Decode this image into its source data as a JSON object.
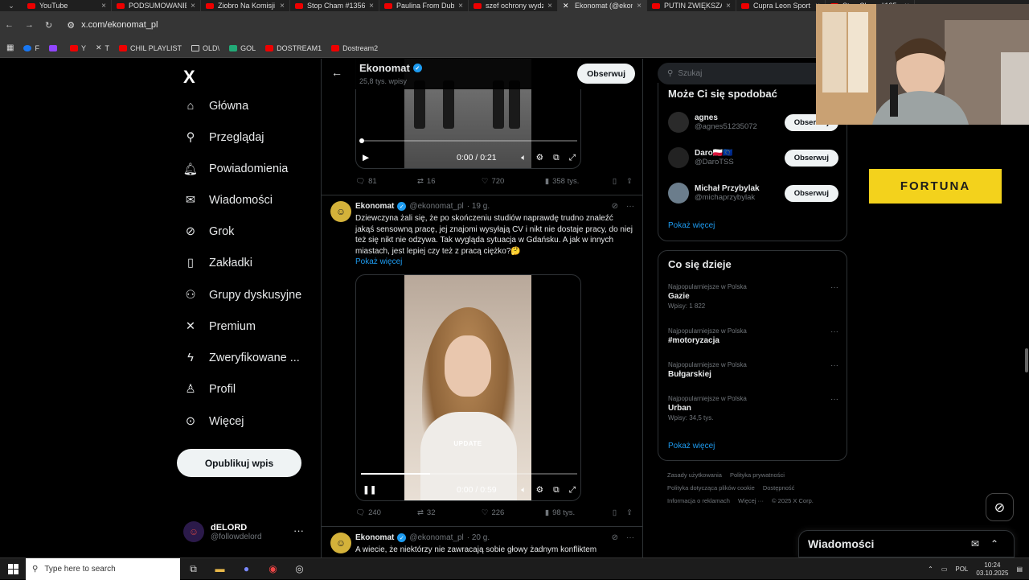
{
  "browser": {
    "tabs": [
      {
        "title": "YouTube",
        "icon": "youtube-icon"
      },
      {
        "title": "PODSUMOWANIE",
        "icon": "youtube-icon"
      },
      {
        "title": "Ziobro Na Komisji",
        "icon": "youtube-icon"
      },
      {
        "title": "Stop Cham #1356",
        "icon": "youtube-icon"
      },
      {
        "title": "Paulina From Dub",
        "icon": "youtube-icon"
      },
      {
        "title": "szef ochrony wydz",
        "icon": "youtube-icon"
      },
      {
        "title": "Ekonomat (@ekon",
        "icon": "x-icon",
        "active": true
      },
      {
        "title": "PUTIN ZWIĘKSZA",
        "icon": "youtube-icon"
      },
      {
        "title": "Cupra Leon Sport",
        "icon": "youtube-icon"
      },
      {
        "title": "Stop Cham #135",
        "icon": "youtube-icon"
      }
    ],
    "url": "x.com/ekonomat_pl",
    "bookmarks": [
      {
        "label": "F",
        "icon": "facebook-icon"
      },
      {
        "label": "",
        "icon": "twitch-icon"
      },
      {
        "label": "Y",
        "icon": "youtube-icon"
      },
      {
        "label": "T",
        "icon": "x-icon"
      },
      {
        "label": "CHIL PLAYLIST",
        "icon": "youtube-icon"
      },
      {
        "label": "OLD\\",
        "icon": "folder-icon"
      },
      {
        "label": "GOL",
        "icon": "gol-icon"
      },
      {
        "label": "DOSTREAM1",
        "icon": "youtube-icon"
      },
      {
        "label": "Dostream2",
        "icon": "youtube-icon"
      }
    ]
  },
  "nav": {
    "logo": "X",
    "items": [
      {
        "label": "Główna",
        "icon": "home-icon",
        "glyph": "⌂"
      },
      {
        "label": "Przeglądaj",
        "icon": "search-icon",
        "glyph": "⚲"
      },
      {
        "label": "Powiadomienia",
        "icon": "bell-icon",
        "glyph": "🔔︎"
      },
      {
        "label": "Wiadomości",
        "icon": "mail-icon",
        "glyph": "✉"
      },
      {
        "label": "Grok",
        "icon": "grok-icon",
        "glyph": "⊘"
      },
      {
        "label": "Zakładki",
        "icon": "bookmark-icon",
        "glyph": "▯"
      },
      {
        "label": "Grupy dyskusyjne",
        "icon": "people-icon",
        "glyph": "⚇"
      },
      {
        "label": "Premium",
        "icon": "x-premium-icon",
        "glyph": "✕"
      },
      {
        "label": "Zweryfikowane ...",
        "icon": "lightning-icon",
        "glyph": "ϟ"
      },
      {
        "label": "Profil",
        "icon": "profile-icon",
        "glyph": "♙"
      },
      {
        "label": "Więcej",
        "icon": "more-circle-icon",
        "glyph": "⊙"
      }
    ],
    "post_button": "Opublikuj wpis",
    "user": {
      "name": "dELORD",
      "handle": "@followdelord"
    }
  },
  "main": {
    "title": "Ekonomat",
    "subtitle": "25,8 tys. wpisy",
    "follow": "Obserwuj",
    "video1": {
      "time": "0:00 / 0:21"
    },
    "tweet1_stats": {
      "replies": "81",
      "reposts": "16",
      "likes": "720",
      "views": "358 tys."
    },
    "tweet2": {
      "name": "Ekonomat",
      "handle": "@ekonomat_pl",
      "time": "· 19 g.",
      "text": "Dziewczyna żali się, że po skończeniu studiów naprawdę trudno znaleźć jakąś sensowną pracę, jej znajomi wysyłają CV i nikt nie dostaje pracy, do niej też się nikt nie odzywa. Tak wygląda sytuacja w Gdańsku. A jak w innych miastach, jest lepiej czy też z pracą ciężko?🤔",
      "show_more": "Pokaż więcej",
      "video_overlay": "UPDATE",
      "video_time": "0:00 / 0:59",
      "progress": 0.32,
      "stats": {
        "replies": "240",
        "reposts": "32",
        "likes": "226",
        "views": "98 tys."
      }
    },
    "tweet3": {
      "name": "Ekonomat",
      "handle": "@ekonomat_pl",
      "time": "· 20 g.",
      "text": "A wiecie, że niektórzy nie zawracają sobie głowy żadnym konfliktem"
    }
  },
  "right": {
    "search_placeholder": "Szukaj",
    "wtf_title": "Może Ci się spodobać",
    "wtf": [
      {
        "name": "agnes",
        "handle": "@agnes51235072",
        "button": "Obserwuj"
      },
      {
        "name": "Daro🇵🇱🇪🇺",
        "handle": "@DaroTSS",
        "button": "Obserwuj"
      },
      {
        "name": "Michał Przybylak",
        "handle": "@michaprzybylak",
        "button": "Obserwuj"
      }
    ],
    "wtf_more": "Pokaż więcej",
    "trends_title": "Co się dzieje",
    "trends": [
      {
        "category": "Najpopularniejsze w Polska",
        "name": "Gazie",
        "count": "Wpisy: 1 822"
      },
      {
        "category": "Najpopularniejsze w Polska",
        "name": "#motoryzacja",
        "count": ""
      },
      {
        "category": "Najpopularniejsze w Polska",
        "name": "Bułgarskiej",
        "count": ""
      },
      {
        "category": "Najpopularniejsze w Polska",
        "name": "Urban",
        "count": "Wpisy: 34,5 tys."
      }
    ],
    "trends_more": "Pokaż więcej",
    "footer": [
      "Zasady użytkowania",
      "Polityka prywatności",
      "Polityka dotycząca plików cookie",
      "Dostępność",
      "Informacja o reklamach",
      "Więcej ···",
      "© 2025 X Corp."
    ],
    "ad_text": "FORTUNA",
    "messages": "Wiadomości"
  },
  "taskbar": {
    "search_placeholder": "Type here to search",
    "lang": "POL",
    "time": "10:24",
    "date": "03.10.2025"
  }
}
